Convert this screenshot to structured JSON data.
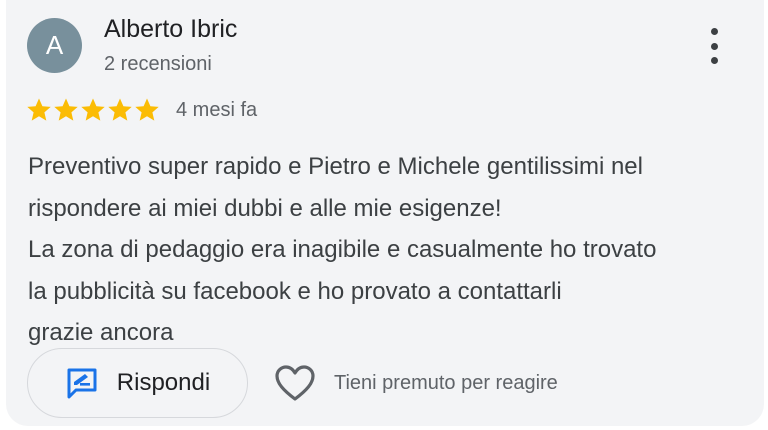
{
  "review": {
    "avatar_letter": "A",
    "avatar_color": "#78909c",
    "author_name": "Alberto Ibric",
    "review_count": "2 recensioni",
    "rating": 5,
    "rating_max": 5,
    "star_color": "#fbbc04",
    "date": "4 mesi fa",
    "text_lines": [
      "Preventivo super rapido e Pietro e Michele gentilissimi nel",
      "rispondere ai miei dubbi e alle mie esigenze!",
      "La zona di pedaggio era inagibile e casualmente ho trovato",
      "la pubblicità su facebook e ho provato a contattarli",
      "grazie ancora"
    ],
    "menu_icon": "more-vert-icon"
  },
  "actions": {
    "reply_label": "Rispondi",
    "reply_icon": "reply-edit-icon",
    "reply_icon_color": "#1a73e8",
    "react_icon": "heart-outline-icon",
    "react_label": "Tieni premuto per reagire"
  }
}
